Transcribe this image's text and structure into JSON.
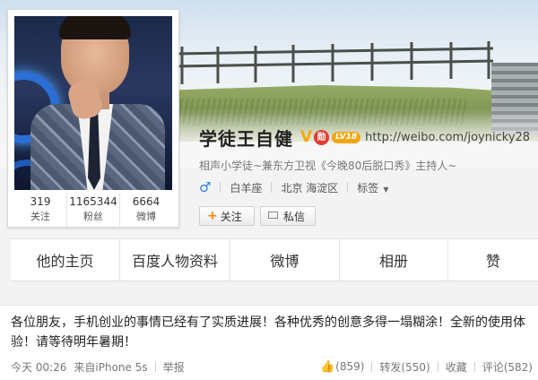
{
  "profile": {
    "name": "学徒王自健",
    "verified_badge": "V",
    "medal_text": "🎖",
    "level": "LV18",
    "url": "http://weibo.com/joynicky28",
    "bio": "相声小学徒~兼东方卫视《今晚80后脱口秀》主持人~",
    "gender_symbol": "♂",
    "constellation": "白羊座",
    "location": "北京 海淀区",
    "tags_label": "标签"
  },
  "stats": [
    {
      "value": "319",
      "label": "关注"
    },
    {
      "value": "1165344",
      "label": "粉丝"
    },
    {
      "value": "6664",
      "label": "微博"
    }
  ],
  "buttons": {
    "follow_plus": "+",
    "follow_label": "关注",
    "message_label": "私信"
  },
  "tabs": [
    {
      "label": "他的主页"
    },
    {
      "label": "百度人物资料"
    },
    {
      "label": "微博"
    },
    {
      "label": "相册"
    },
    {
      "label": "赞"
    }
  ],
  "post": {
    "text": "各位朋友，手机创业的事情已经有了实质进展！各种优秀的创意多得一塌糊涂！全新的使用体验！请等待明年暑期！",
    "time": "今天 00:26",
    "source": "来自iPhone 5s",
    "report": "举报",
    "likes": "(859)",
    "repost": "转发(550)",
    "favorite": "收藏",
    "comment": "评论(582)"
  },
  "icons": {
    "gender": "male-icon",
    "like": "thumbs-up-icon",
    "message": "envelope-icon",
    "caret": "caret-down-icon"
  },
  "colors": {
    "verified": "#f5a800",
    "gender": "#2c7be5",
    "follow_plus": "#ff8400",
    "like": "#3d86d6"
  }
}
